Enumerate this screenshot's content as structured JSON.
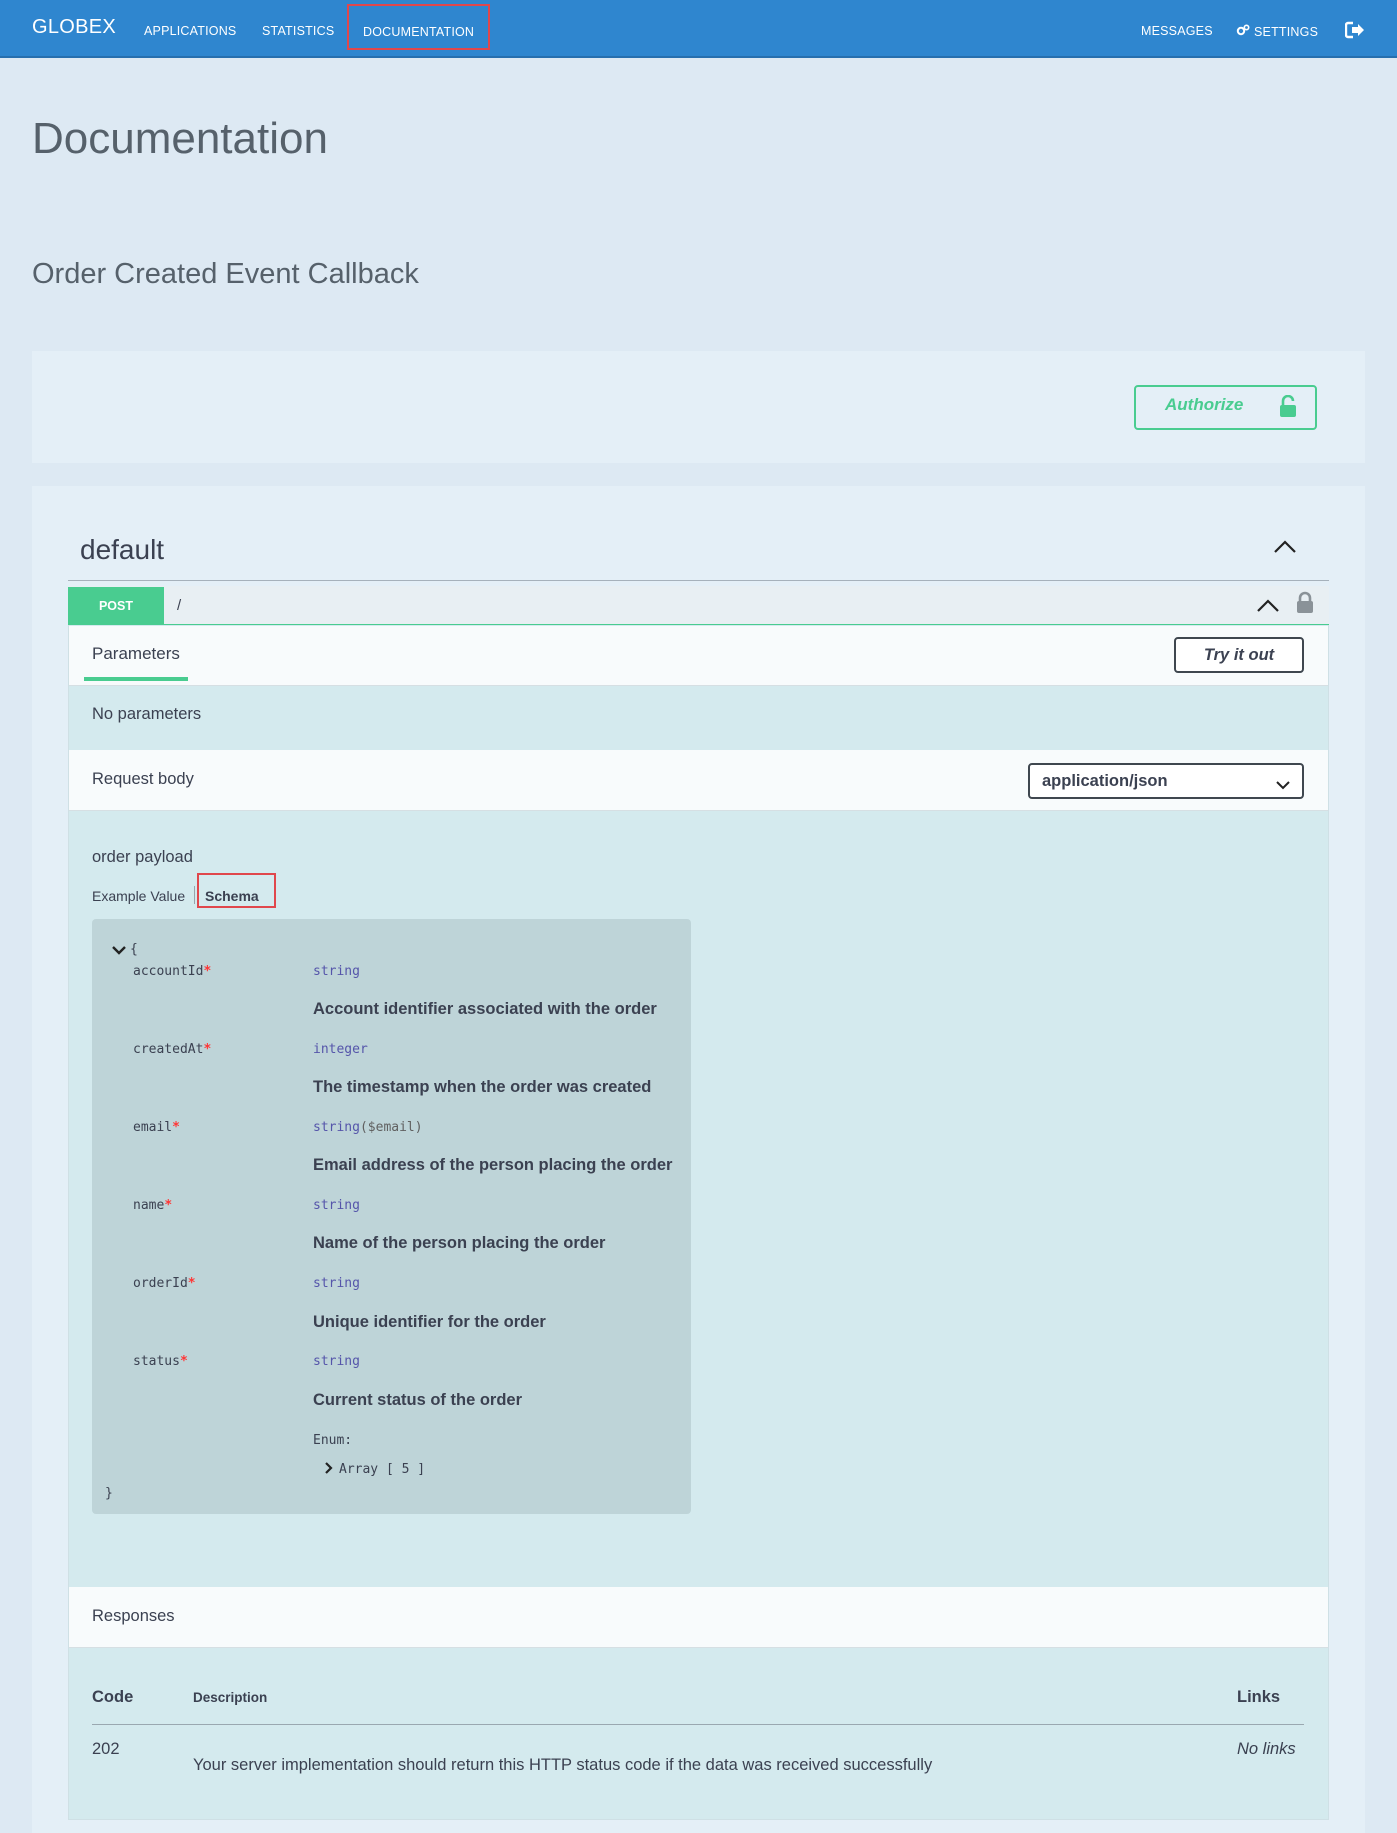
{
  "nav": {
    "brand": "GLOBEX",
    "items": [
      {
        "label": "APPLICATIONS"
      },
      {
        "label": "STATISTICS"
      },
      {
        "label": "DOCUMENTATION"
      }
    ],
    "right": {
      "messages": "MESSAGES",
      "settings": "SETTINGS",
      "settings_icon": "gear-icon",
      "logout_icon": "logout-icon"
    }
  },
  "page": {
    "title": "Documentation",
    "api_title": "Order Created Event Callback"
  },
  "authorize": {
    "label": "Authorize",
    "icon": "unlocked-padlock-icon"
  },
  "tag": {
    "name": "default"
  },
  "operation": {
    "method": "POST",
    "path": "/",
    "tabs": {
      "parameters": "Parameters"
    },
    "try_it_out": "Try it out",
    "no_parameters": "No parameters",
    "request_body": {
      "label": "Request body",
      "content_type": "application/json",
      "description": "order payload",
      "example_tab": "Example Value",
      "schema_tab": "Schema"
    },
    "schema": {
      "open": "{",
      "close": "}",
      "properties": [
        {
          "name": "accountId",
          "type": "string",
          "format": "",
          "description": "Account identifier associated with the order"
        },
        {
          "name": "createdAt",
          "type": "integer",
          "format": "",
          "description": "The timestamp when the order was created"
        },
        {
          "name": "email",
          "type": "string",
          "format": "($email)",
          "description": "Email address of the person placing the order"
        },
        {
          "name": "name",
          "type": "string",
          "format": "",
          "description": "Name of the person placing the order"
        },
        {
          "name": "orderId",
          "type": "string",
          "format": "",
          "description": "Unique identifier for the order"
        },
        {
          "name": "status",
          "type": "string",
          "format": "",
          "description": "Current status of the order"
        }
      ],
      "required_marker": "*",
      "enum_label": "Enum:",
      "enum_array": "Array [ 5 ]"
    },
    "responses": {
      "label": "Responses",
      "columns": {
        "code": "Code",
        "description": "Description",
        "links": "Links"
      },
      "rows": [
        {
          "code": "202",
          "description": "Your server implementation should return this HTTP status code if the data was received successfully",
          "links": "No links"
        }
      ]
    }
  },
  "colors": {
    "navbar": "#2f86cf",
    "post": "#49cc90",
    "highlight": "#e0474c",
    "required": "#ff3636"
  }
}
